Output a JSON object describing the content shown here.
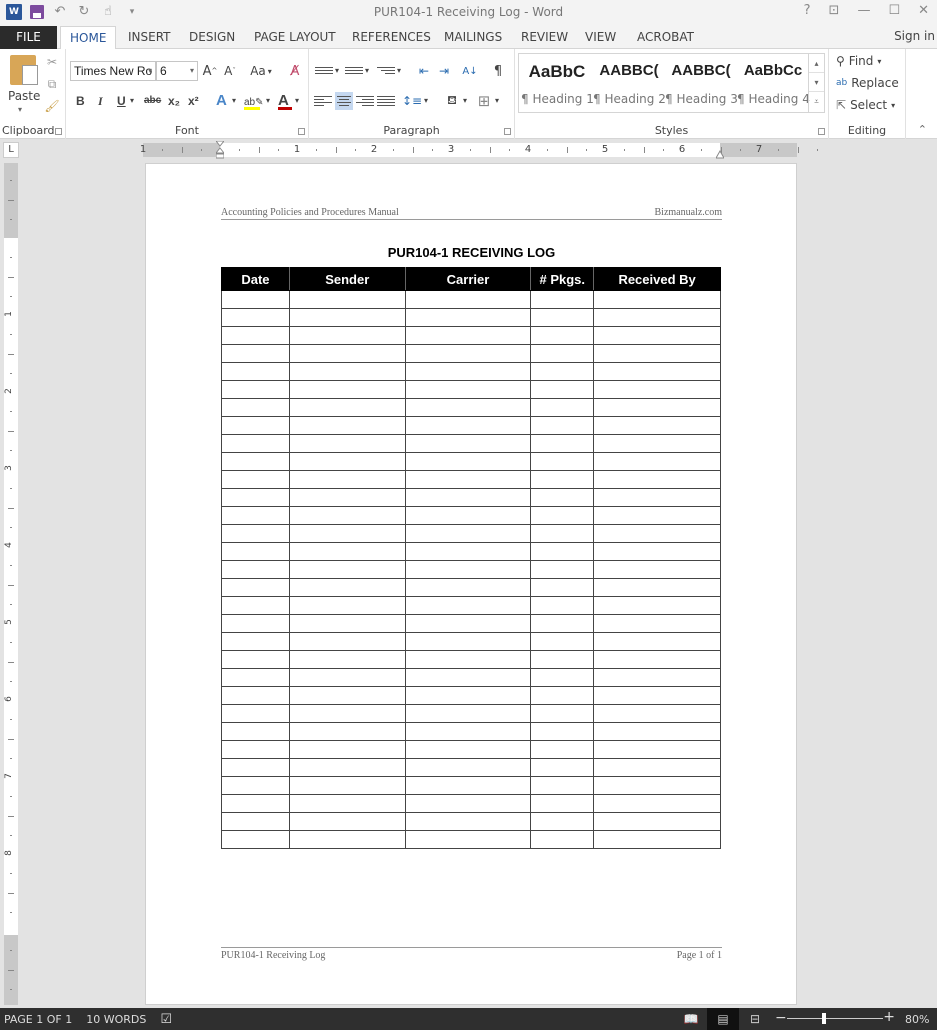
{
  "window": {
    "title": "PUR104-1 Receiving Log - Word",
    "controls": [
      "?",
      "ribbon-display",
      "minimize",
      "maximize",
      "close"
    ]
  },
  "qat": {
    "app_icon": "W",
    "items": [
      "save-icon",
      "undo-icon",
      "redo-icon",
      "touch-mode-icon",
      "customize-icon"
    ]
  },
  "tabs": {
    "items": [
      {
        "label": "FILE"
      },
      {
        "label": "HOME",
        "active": true
      },
      {
        "label": "INSERT"
      },
      {
        "label": "DESIGN"
      },
      {
        "label": "PAGE LAYOUT"
      },
      {
        "label": "REFERENCES"
      },
      {
        "label": "MAILINGS"
      },
      {
        "label": "REVIEW"
      },
      {
        "label": "VIEW"
      },
      {
        "label": "ACROBAT"
      }
    ],
    "sign_in": "Sign in"
  },
  "ribbon": {
    "clipboard": {
      "label": "Clipboard",
      "paste": "Paste"
    },
    "font": {
      "label": "Font",
      "font_name": "Times New Ro",
      "font_size": "6",
      "change_case": "Aa",
      "bold": "B",
      "italic": "I",
      "underline": "U",
      "strikethrough": "abc",
      "subscript": "x₂",
      "superscript": "x²",
      "highlight_color": "#ffff00",
      "font_color": "#c00000"
    },
    "paragraph": {
      "label": "Paragraph",
      "pilcrow": "¶",
      "active_alignment": "center"
    },
    "styles": {
      "label": "Styles",
      "items": [
        {
          "sample": "AaBbC",
          "name": "¶ Heading 1"
        },
        {
          "sample": "AABBC(",
          "name": "¶ Heading 2"
        },
        {
          "sample": "AABBC(",
          "name": "¶ Heading 3"
        },
        {
          "sample": "AaBbCc",
          "name": "¶ Heading 4"
        }
      ]
    },
    "editing": {
      "label": "Editing",
      "find": "Find",
      "replace": "Replace",
      "select": "Select"
    }
  },
  "ruler": {
    "horizontal_numbers": [
      "1",
      "1",
      "2",
      "3",
      "4",
      "5",
      "6",
      "7"
    ],
    "vertical_numbers": [
      "1",
      "1",
      "2",
      "3",
      "4",
      "5",
      "6",
      "7",
      "8"
    ],
    "tab_selector": "L"
  },
  "document": {
    "header_left": "Accounting Policies and Procedures Manual",
    "header_right": "Bizmanualz.com",
    "title": "PUR104-1 RECEIVING LOG",
    "table": {
      "columns": [
        "Date",
        "Sender",
        "Carrier",
        "# Pkgs.",
        "Received By"
      ],
      "empty_row_count": 31
    },
    "footer_left": "PUR104-1 Receiving Log",
    "footer_right": "Page 1 of 1"
  },
  "statusbar": {
    "page": "PAGE 1 OF 1",
    "words": "10 WORDS",
    "zoom": "80%",
    "zoom_level_percent": 80,
    "active_view": "print-layout"
  }
}
